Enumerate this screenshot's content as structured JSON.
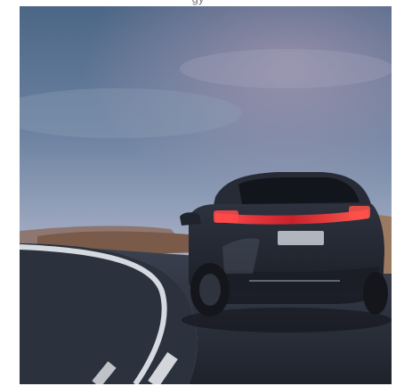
{
  "page": {
    "top_caption": "gy"
  },
  "photo": {
    "subject": "dark-suv-rear-on-winding-road",
    "dominant_colors": {
      "sky_top": "#4f6a8a",
      "sky_mid": "#8fa1b8",
      "sky_horizon": "#c9a7b6",
      "road": "#2a2f3b",
      "car_body": "#232733",
      "taillight": "#d8323a",
      "road_marking": "#e9edf3"
    }
  }
}
